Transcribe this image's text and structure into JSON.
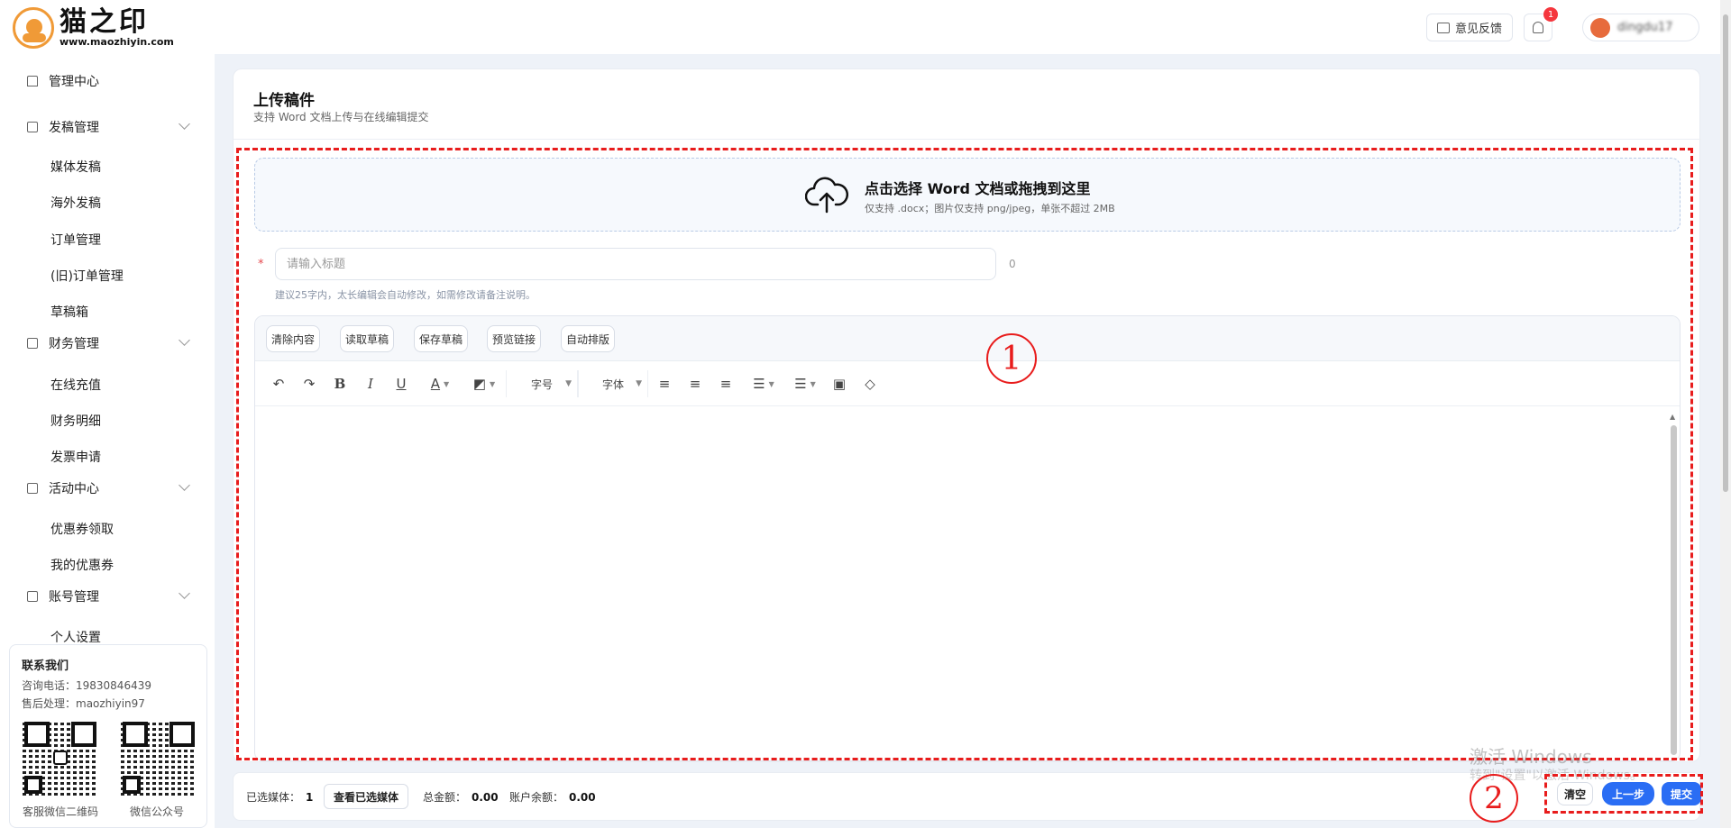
{
  "header": {
    "logo_cn": "猫之印",
    "logo_url": "www.maozhiyin.com",
    "feedback_label": "意见反馈",
    "notification_count": "1",
    "username": "dingdu17"
  },
  "sidebar": {
    "items": [
      {
        "label": "管理中心"
      },
      {
        "label": "发稿管理",
        "sub": [
          "媒体发稿",
          "海外发稿",
          "订单管理",
          "(旧)订单管理",
          "草稿箱"
        ]
      },
      {
        "label": "财务管理",
        "sub": [
          "在线充值",
          "财务明细",
          "发票申请"
        ]
      },
      {
        "label": "活动中心",
        "sub": [
          "优惠券领取",
          "我的优惠券"
        ]
      },
      {
        "label": "账号管理",
        "sub": [
          "个人设置"
        ]
      }
    ],
    "contact": {
      "title": "联系我们",
      "phone": "咨询电话：19830846439",
      "after_sales": "售后处理：maozhiyin97",
      "qr1_caption": "客服微信二维码",
      "qr2_caption": "微信公众号"
    }
  },
  "main": {
    "title": "上传稿件",
    "subtitle": "支持 Word 文档上传与在线编辑提交",
    "upload_title": "点击选择 Word 文档或拖拽到这里",
    "upload_sub": "仅支持 .docx；图片仅支持 png/jpeg，单张不超过 2MB",
    "title_placeholder": "请输入标题",
    "title_value": "",
    "title_count": "0",
    "title_hint": "建议25字内，太长编辑会自动修改，如需修改请备注说明。",
    "editor_buttons": [
      "清除内容",
      "读取草稿",
      "保存草稿",
      "预览链接",
      "自动排版"
    ],
    "toolbar": {
      "font_size": "字号",
      "font_family": "字体",
      "icons": [
        "undo-icon",
        "redo-icon",
        "bold-icon",
        "italic-icon",
        "underline-icon",
        "font-color-icon",
        "highlight-icon",
        "align-left-icon",
        "align-center-icon",
        "align-right-icon",
        "bullet-list-icon",
        "numbered-list-icon",
        "image-icon",
        "eraser-icon"
      ]
    }
  },
  "bottom": {
    "selected_media_label": "已选媒体：",
    "selected_media_value": "1",
    "view_selected": "查看已选媒体",
    "total_label": "总金额：",
    "total_value": "0.00",
    "balance_label": "账户余额：",
    "balance_value": "0.00",
    "clear": "清空",
    "prev": "上一步",
    "submit": "提交"
  },
  "annotations": {
    "marker1": "1",
    "marker2": "2"
  },
  "watermark": {
    "line1": "激活 Windows",
    "line2": "转到\"设置\"以激活 Windows。"
  },
  "colors": {
    "accent": "#2a6df4",
    "annotation": "#e81c1c",
    "brand": "#f09a37"
  }
}
